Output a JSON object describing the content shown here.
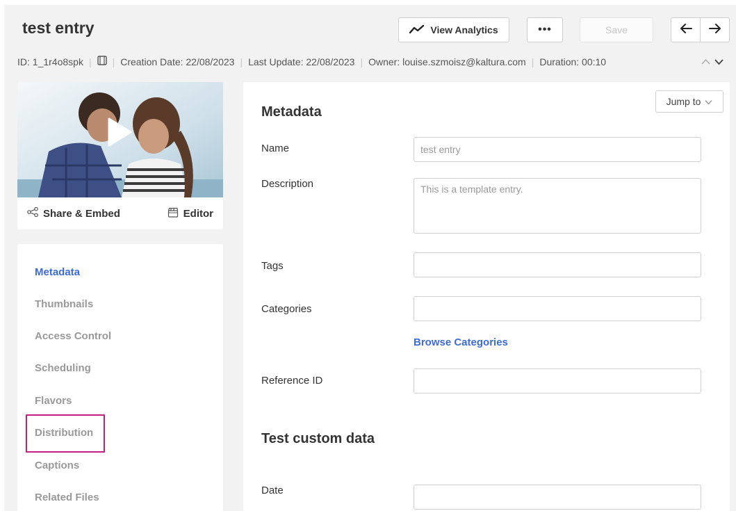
{
  "header": {
    "title": "test entry",
    "view_analytics_label": "View Analytics",
    "more_label": "•••",
    "save_label": "Save",
    "prev_icon": "arrow-left-icon",
    "next_icon": "arrow-right-icon"
  },
  "info_bar": {
    "id": "ID: 1_1r4o8spk",
    "media_type_icon": "film-icon",
    "creation_date": "Creation Date: 22/08/2023",
    "last_update": "Last Update: 22/08/2023",
    "owner": "Owner: louise.szmoisz@kaltura.com",
    "duration": "Duration: 00:10"
  },
  "thumbnail": {
    "share_embed_label": "Share & Embed",
    "editor_label": "Editor"
  },
  "sidebar": {
    "items": [
      {
        "label": "Metadata",
        "active": true
      },
      {
        "label": "Thumbnails",
        "active": false
      },
      {
        "label": "Access Control",
        "active": false
      },
      {
        "label": "Scheduling",
        "active": false
      },
      {
        "label": "Flavors",
        "active": false
      },
      {
        "label": "Distribution",
        "active": false
      },
      {
        "label": "Captions",
        "active": false
      },
      {
        "label": "Related Files",
        "active": false
      }
    ],
    "highlighted_item": "Distribution"
  },
  "panel": {
    "jump_to_label": "Jump to",
    "metadata_title": "Metadata",
    "fields": {
      "name": {
        "label": "Name",
        "placeholder": "test entry",
        "value": ""
      },
      "description": {
        "label": "Description",
        "placeholder": "This is a template entry.",
        "value": ""
      },
      "tags": {
        "label": "Tags",
        "value": ""
      },
      "categories": {
        "label": "Categories",
        "value": ""
      },
      "reference_id": {
        "label": "Reference ID",
        "value": ""
      }
    },
    "browse_categories_label": "Browse Categories",
    "custom_data_title": "Test custom data",
    "custom_fields": {
      "date": {
        "label": "Date",
        "value": ""
      }
    }
  },
  "colors": {
    "accent": "#3d6bd6",
    "highlight": "#c71f7f",
    "background": "#f2f2f2"
  }
}
